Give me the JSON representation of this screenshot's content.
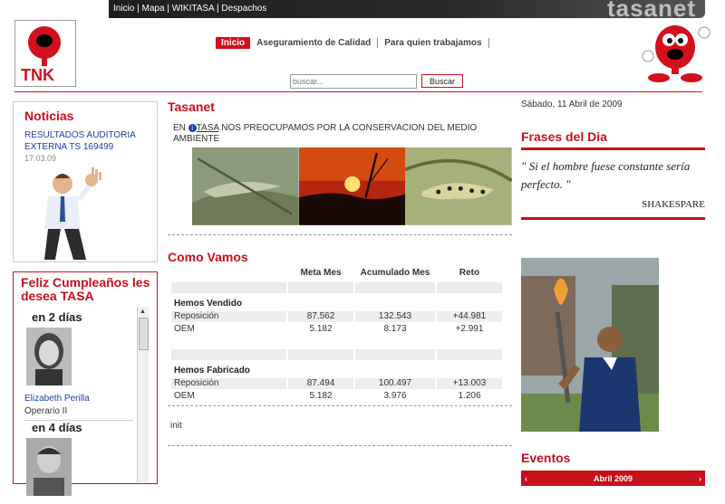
{
  "topbar": {
    "links": [
      "Inicio",
      "Mapa",
      "WIKITASA",
      "Despachos"
    ],
    "separator": " | ",
    "brand": "tasanet"
  },
  "logo": {
    "text": "TNK"
  },
  "nav": {
    "active": "Inicio",
    "items": [
      "Aseguramiento de Calidad",
      "Para quien trabajamos"
    ]
  },
  "search": {
    "placeholder": "buscar...",
    "button": "Buscar"
  },
  "noticias": {
    "title": "Noticias",
    "link": "RESULTADOS AUDITORIA EXTERNA TS 169499",
    "date": "17.03.09"
  },
  "cumple": {
    "title": "Feliz Cumpleaños les desea TASA",
    "people": [
      {
        "days": "en 2 días",
        "name": "Elizabeth Perilla",
        "role": "Operario II"
      },
      {
        "days": "en 4 días",
        "name": "",
        "role": ""
      }
    ]
  },
  "tasanet": {
    "title": "Tasanet",
    "intro_prefix": "EN ",
    "intro_link": "TASA",
    "intro_rest": " NOS PREOCUPAMOS POR LA CONSERVACION DEL MEDIO AMBIENTE"
  },
  "como_vamos": {
    "title": "Como Vamos",
    "headers": [
      "Meta Mes",
      "Acumulado Mes",
      "Reto"
    ],
    "groups": [
      {
        "name": "Hemos Vendido",
        "rows": [
          {
            "label": "Reposición",
            "meta": "87.562",
            "acum": "132.543",
            "reto": "+44.981"
          },
          {
            "label": "OEM",
            "meta": "5.182",
            "acum": "8.173",
            "reto": "+2.991"
          }
        ]
      },
      {
        "name": "Hemos Fabricado",
        "rows": [
          {
            "label": "Reposición",
            "meta": "87.494",
            "acum": "100.497",
            "reto": "+13.003"
          },
          {
            "label": "OEM",
            "meta": "5.182",
            "acum": "3.976",
            "reto": "1.206"
          }
        ]
      }
    ]
  },
  "init_text": "init",
  "right": {
    "date": "Sábado, 11 Abril de 2009",
    "frases_title": "Frases del Dia",
    "quote": "\" Si el hombre fuese constante sería perfecto. \"",
    "author": "SHAKESPARE",
    "eventos_title": "Eventos",
    "calendar": {
      "month": "Abril 2009",
      "prev": "‹",
      "next": "›"
    }
  },
  "colors": {
    "brand_red": "#c8101a",
    "link_blue": "#1c3fa6"
  }
}
